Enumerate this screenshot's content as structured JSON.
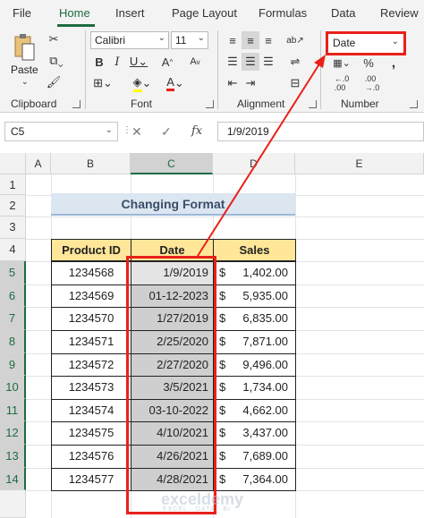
{
  "tabs": [
    "File",
    "Home",
    "Insert",
    "Page Layout",
    "Formulas",
    "Data",
    "Review"
  ],
  "ribbon": {
    "clipboard": {
      "label": "Clipboard",
      "paste": "Paste"
    },
    "font": {
      "label": "Font",
      "name": "Calibri",
      "size": "11"
    },
    "alignment": {
      "label": "Alignment"
    },
    "number": {
      "label": "Number",
      "format": "Date"
    }
  },
  "formula_bar": {
    "name_box": "C5",
    "value": "1/9/2019",
    "fx": "fx"
  },
  "columns": [
    "A",
    "B",
    "C",
    "D",
    "E"
  ],
  "rows": [
    "1",
    "2",
    "3",
    "4",
    "5",
    "6",
    "7",
    "8",
    "9",
    "10",
    "11",
    "12",
    "13",
    "14"
  ],
  "sheet": {
    "title": "Changing Format",
    "headers": [
      "Product ID",
      "Date",
      "Sales"
    ],
    "data": [
      {
        "id": "1234568",
        "date": "1/9/2019",
        "cur": "$",
        "sales": "1,402.00"
      },
      {
        "id": "1234569",
        "date": "01-12-2023",
        "cur": "$",
        "sales": "5,935.00"
      },
      {
        "id": "1234570",
        "date": "1/27/2019",
        "cur": "$",
        "sales": "6,835.00"
      },
      {
        "id": "1234571",
        "date": "2/25/2020",
        "cur": "$",
        "sales": "7,871.00"
      },
      {
        "id": "1234572",
        "date": "2/27/2020",
        "cur": "$",
        "sales": "9,496.00"
      },
      {
        "id": "1234573",
        "date": "3/5/2021",
        "cur": "$",
        "sales": "1,734.00"
      },
      {
        "id": "1234574",
        "date": "03-10-2022",
        "cur": "$",
        "sales": "4,662.00"
      },
      {
        "id": "1234575",
        "date": "4/10/2021",
        "cur": "$",
        "sales": "3,437.00"
      },
      {
        "id": "1234576",
        "date": "4/26/2021",
        "cur": "$",
        "sales": "7,689.00"
      },
      {
        "id": "1234577",
        "date": "4/28/2021",
        "cur": "$",
        "sales": "7,364.00"
      }
    ]
  },
  "watermark": {
    "brand": "exceldemy",
    "tagline": "EXCEL · DATA · BI"
  },
  "colors": {
    "accent": "#1e6b41",
    "highlight": "#e8211a",
    "header_fill": "#ffe699",
    "title_fill": "#dce6f1",
    "date_fill": "#cfcfcf"
  }
}
